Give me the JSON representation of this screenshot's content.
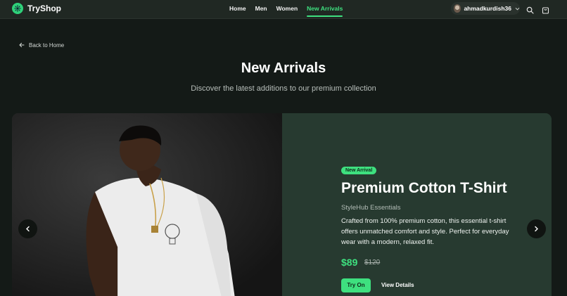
{
  "header": {
    "brand": "TryShop",
    "nav": [
      {
        "label": "Home",
        "active": false
      },
      {
        "label": "Men",
        "active": false
      },
      {
        "label": "Women",
        "active": false
      },
      {
        "label": "New Arrivals",
        "active": true
      }
    ],
    "username": "ahmadkurdish36",
    "icons": [
      "logo-icon",
      "chevron-down-icon",
      "search-icon",
      "shopping-bag-icon"
    ]
  },
  "back_link": {
    "label": "Back to Home",
    "icon": "arrow-left-icon"
  },
  "page": {
    "title": "New Arrivals",
    "subtitle": "Discover the latest additions to our premium collection"
  },
  "product": {
    "badge": "New Arrival",
    "name": "Premium Cotton T-Shirt",
    "brand": "StyleHub Essentials",
    "description": "Crafted from 100% premium cotton, this essential t-shirt offers unmatched comfort and style. Perfect for everyday wear with a modern, relaxed fit.",
    "price": "$89",
    "original_price": "$120",
    "try_on_label": "Try On",
    "view_details_label": "View Details"
  },
  "carousel": {
    "prev_icon": "chevron-left-icon",
    "next_icon": "chevron-right-icon"
  },
  "colors": {
    "accent": "#3ee07f",
    "background": "#141a17",
    "panel": "#273a30"
  }
}
